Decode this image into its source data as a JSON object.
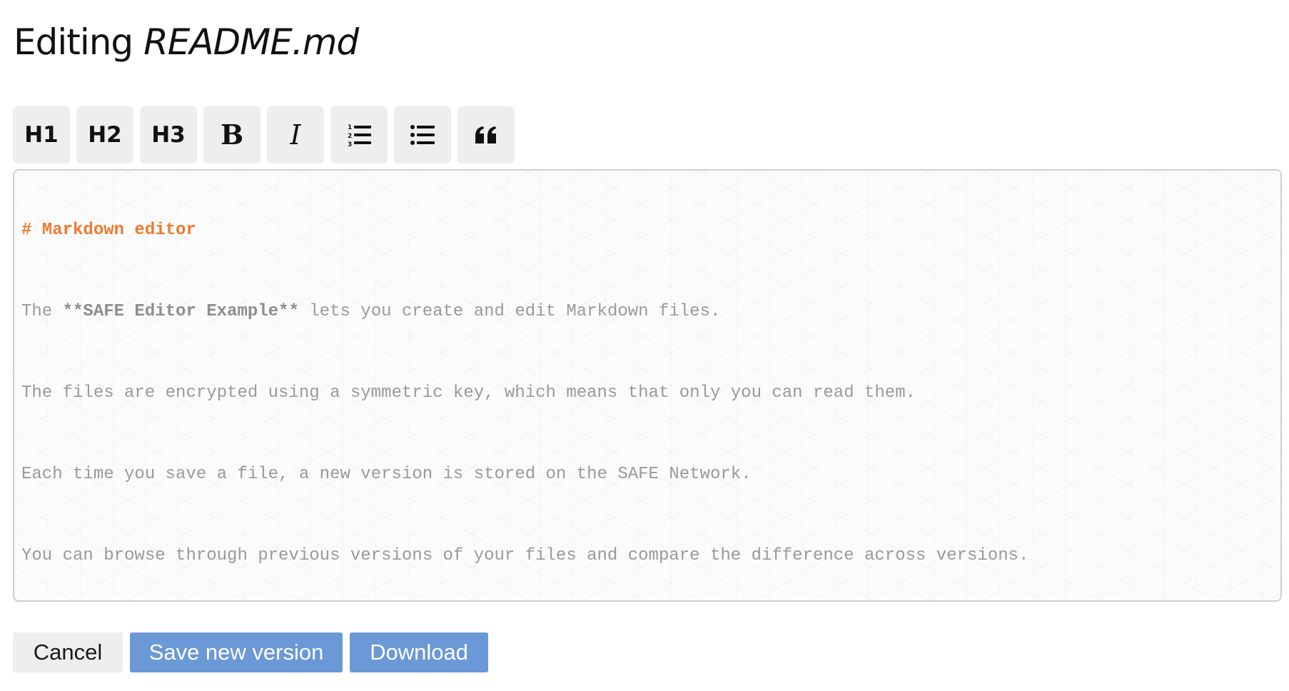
{
  "page": {
    "title_prefix": "Editing",
    "filename": "README.md"
  },
  "toolbar": {
    "h1_label": "H1",
    "h2_label": "H2",
    "h3_label": "H3",
    "bold_icon": "bold-icon",
    "italic_icon": "italic-icon",
    "ordered_list_icon": "ordered-list-icon",
    "bullet_list_icon": "bullet-list-icon",
    "quote_icon": "quote-icon"
  },
  "editor": {
    "heading": "# Markdown editor",
    "line1_before": "The ",
    "line1_strong": "**SAFE Editor Example**",
    "line1_after": " lets you create and edit Markdown files.",
    "line2": "The files are encrypted using a symmetric key, which means that only you can read them.",
    "line3": "Each time you save a file, a new version is stored on the SAFE Network.",
    "line4": "You can browse through previous versions of your files and compare the difference across versions."
  },
  "actions": {
    "cancel_label": "Cancel",
    "save_label": "Save new version",
    "download_label": "Download"
  },
  "colors": {
    "heading_accent": "#ee7b30",
    "primary_button": "#6b98d6",
    "secondary_button": "#eeeeee",
    "editor_text": "#9a9a9a"
  }
}
